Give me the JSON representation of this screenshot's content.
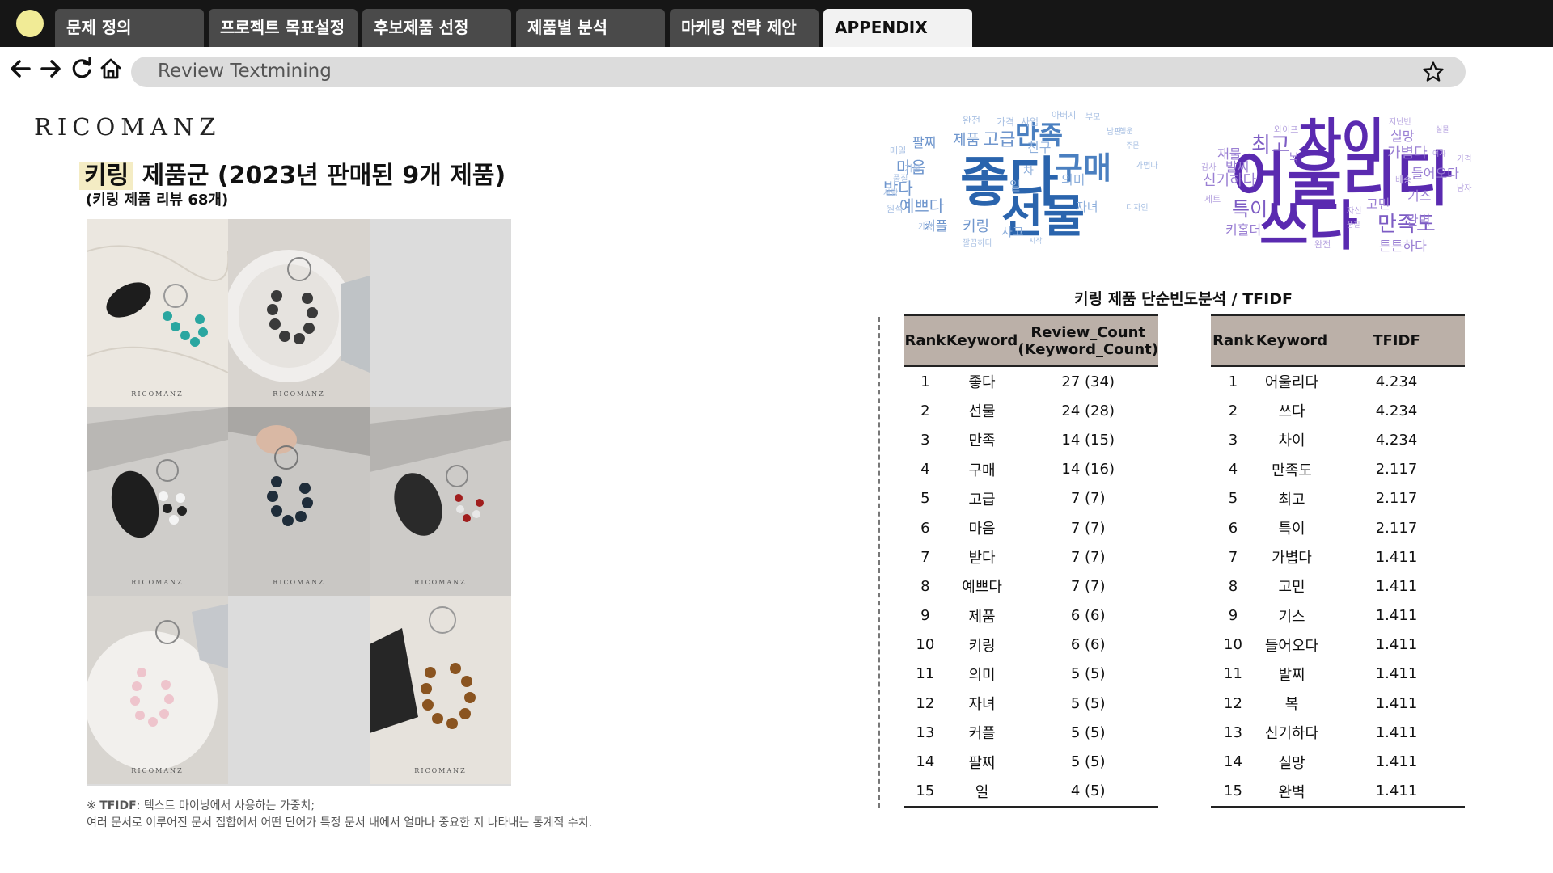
{
  "browser": {
    "tabs": [
      "문제 정의",
      "프로젝트 목표설정",
      "후보제품 선정",
      "제품별 분석",
      "마케팅 전략 제안",
      "APPENDIX"
    ],
    "active_tab_index": 5,
    "address": "Review Textmining",
    "icons": [
      "back-arrow-icon",
      "forward-arrow-icon",
      "reload-icon",
      "home-icon",
      "star-icon"
    ]
  },
  "slide": {
    "logo": "RICOMANZ",
    "title_highlight": "키링",
    "title_rest": " 제품군 (2023년 판매된 9개 제품)",
    "subtitle": "(키링 제품 리뷰 68개)",
    "photo_watermark": "RICOMANZ",
    "footnote_bold": "TFIDF",
    "footnote_line1": ": 텍스트 마이닝에서 사용하는 가중치;",
    "footnote_line2": "여러 문서로 이루어진 문서 집합에서 어떤 단어가 특정 문서 내에서 얼마나 중요한 지 나타내는 통계적 수치."
  },
  "wordcloud_left": [
    {
      "t": "좋다",
      "c": "#2a64ad"
    },
    {
      "t": "선물",
      "c": "#2a64ad"
    },
    {
      "t": "구매",
      "c": "#4a7fc0"
    },
    {
      "t": "만족",
      "c": "#4a7fc0"
    },
    {
      "t": "고급",
      "c": "#6f96cd"
    },
    {
      "t": "제품",
      "c": "#6f96cd"
    },
    {
      "t": "팔찌",
      "c": "#6f96cd"
    },
    {
      "t": "마음",
      "c": "#6f96cd"
    },
    {
      "t": "받다",
      "c": "#6f96cd"
    },
    {
      "t": "예쁘다",
      "c": "#6f96cd"
    },
    {
      "t": "커플",
      "c": "#6f96cd"
    },
    {
      "t": "키링",
      "c": "#6f96cd"
    },
    {
      "t": "친구",
      "c": "#8fb0dc"
    },
    {
      "t": "의미",
      "c": "#8fb0dc"
    },
    {
      "t": "자녀",
      "c": "#8fb0dc"
    },
    {
      "t": "사고",
      "c": "#8fb0dc"
    },
    {
      "t": "일",
      "c": "#8fb0dc"
    },
    {
      "t": "차",
      "c": "#8fb0dc"
    },
    {
      "t": "완전",
      "c": "#a8c0e3"
    },
    {
      "t": "가격",
      "c": "#a8c0e3"
    },
    {
      "t": "사업",
      "c": "#a8c0e3"
    },
    {
      "t": "아버지",
      "c": "#a8c0e3"
    },
    {
      "t": "부모",
      "c": "#a8c0e3"
    },
    {
      "t": "남편",
      "c": "#a8c0e3"
    },
    {
      "t": "행운",
      "c": "#a8c0e3"
    },
    {
      "t": "주문",
      "c": "#a8c0e3"
    },
    {
      "t": "디자인",
      "c": "#a8c0e3"
    },
    {
      "t": "가볍다",
      "c": "#a8c0e3"
    },
    {
      "t": "매일",
      "c": "#a8c0e3"
    },
    {
      "t": "기본",
      "c": "#a8c0e3"
    },
    {
      "t": "원석",
      "c": "#a8c0e3"
    },
    {
      "t": "가방",
      "c": "#a8c0e3"
    },
    {
      "t": "깔끔하다",
      "c": "#a8c0e3"
    },
    {
      "t": "시작",
      "c": "#a8c0e3"
    },
    {
      "t": "품질",
      "c": "#a8c0e3"
    },
    {
      "t": "사람",
      "c": "#a8c0e3"
    }
  ],
  "wordcloud_right": [
    {
      "t": "어울리다",
      "c": "#5a2ab0"
    },
    {
      "t": "차이",
      "c": "#5a2ab0"
    },
    {
      "t": "쓰다",
      "c": "#5a2ab0"
    },
    {
      "t": "만족도",
      "c": "#7d5cc4"
    },
    {
      "t": "최고",
      "c": "#7d5cc4"
    },
    {
      "t": "특이",
      "c": "#7d5cc4"
    },
    {
      "t": "가볍다",
      "c": "#9a7fd3"
    },
    {
      "t": "신기하다",
      "c": "#9a7fd3"
    },
    {
      "t": "실망",
      "c": "#9a7fd3"
    },
    {
      "t": "고민",
      "c": "#9a7fd3"
    },
    {
      "t": "기스",
      "c": "#9a7fd3"
    },
    {
      "t": "완벽",
      "c": "#9a7fd3"
    },
    {
      "t": "들어오다",
      "c": "#9a7fd3"
    },
    {
      "t": "튼튼하다",
      "c": "#9a7fd3"
    },
    {
      "t": "키홀더",
      "c": "#9a7fd3"
    },
    {
      "t": "발찌",
      "c": "#9a7fd3"
    },
    {
      "t": "재물",
      "c": "#9a7fd3"
    },
    {
      "t": "복",
      "c": "#9a7fd3"
    },
    {
      "t": "와이프",
      "c": "#b8a6e0"
    },
    {
      "t": "지난번",
      "c": "#b8a6e0"
    },
    {
      "t": "세트",
      "c": "#b8a6e0"
    },
    {
      "t": "배송",
      "c": "#b8a6e0"
    },
    {
      "t": "남자",
      "c": "#b8a6e0"
    },
    {
      "t": "가격",
      "c": "#b8a6e0"
    },
    {
      "t": "완전",
      "c": "#b8a6e0"
    },
    {
      "t": "여자",
      "c": "#b8a6e0"
    },
    {
      "t": "감사",
      "c": "#b8a6e0"
    },
    {
      "t": "자신",
      "c": "#b8a6e0"
    },
    {
      "t": "실물",
      "c": "#b8a6e0"
    },
    {
      "t": "품질",
      "c": "#b8a6e0"
    }
  ],
  "tables": {
    "title": "키링 제품 단순빈도분석 / TFIDF",
    "freq": {
      "headers": [
        "Rank",
        "Keyword",
        "Review_Count\n(Keyword_Count)"
      ],
      "rows": [
        [
          "1",
          "좋다",
          "27 (34)"
        ],
        [
          "2",
          "선물",
          "24 (28)"
        ],
        [
          "3",
          "만족",
          "14 (15)"
        ],
        [
          "4",
          "구매",
          "14 (16)"
        ],
        [
          "5",
          "고급",
          "7 (7)"
        ],
        [
          "6",
          "마음",
          "7 (7)"
        ],
        [
          "7",
          "받다",
          "7 (7)"
        ],
        [
          "8",
          "예쁘다",
          "7 (7)"
        ],
        [
          "9",
          "제품",
          "6 (6)"
        ],
        [
          "10",
          "키링",
          "6 (6)"
        ],
        [
          "11",
          "의미",
          "5 (5)"
        ],
        [
          "12",
          "자녀",
          "5 (5)"
        ],
        [
          "13",
          "커플",
          "5 (5)"
        ],
        [
          "14",
          "팔찌",
          "5 (5)"
        ],
        [
          "15",
          "일",
          "4 (5)"
        ]
      ]
    },
    "tfidf": {
      "headers": [
        "Rank",
        "Keyword",
        "TFIDF"
      ],
      "rows": [
        [
          "1",
          "어울리다",
          "4.234"
        ],
        [
          "2",
          "쓰다",
          "4.234"
        ],
        [
          "3",
          "차이",
          "4.234"
        ],
        [
          "4",
          "만족도",
          "2.117"
        ],
        [
          "5",
          "최고",
          "2.117"
        ],
        [
          "6",
          "특이",
          "2.117"
        ],
        [
          "7",
          "가볍다",
          "1.411"
        ],
        [
          "8",
          "고민",
          "1.411"
        ],
        [
          "9",
          "기스",
          "1.411"
        ],
        [
          "10",
          "들어오다",
          "1.411"
        ],
        [
          "11",
          "발찌",
          "1.411"
        ],
        [
          "12",
          "복",
          "1.411"
        ],
        [
          "13",
          "신기하다",
          "1.411"
        ],
        [
          "14",
          "실망",
          "1.411"
        ],
        [
          "15",
          "완벽",
          "1.411"
        ]
      ]
    }
  }
}
